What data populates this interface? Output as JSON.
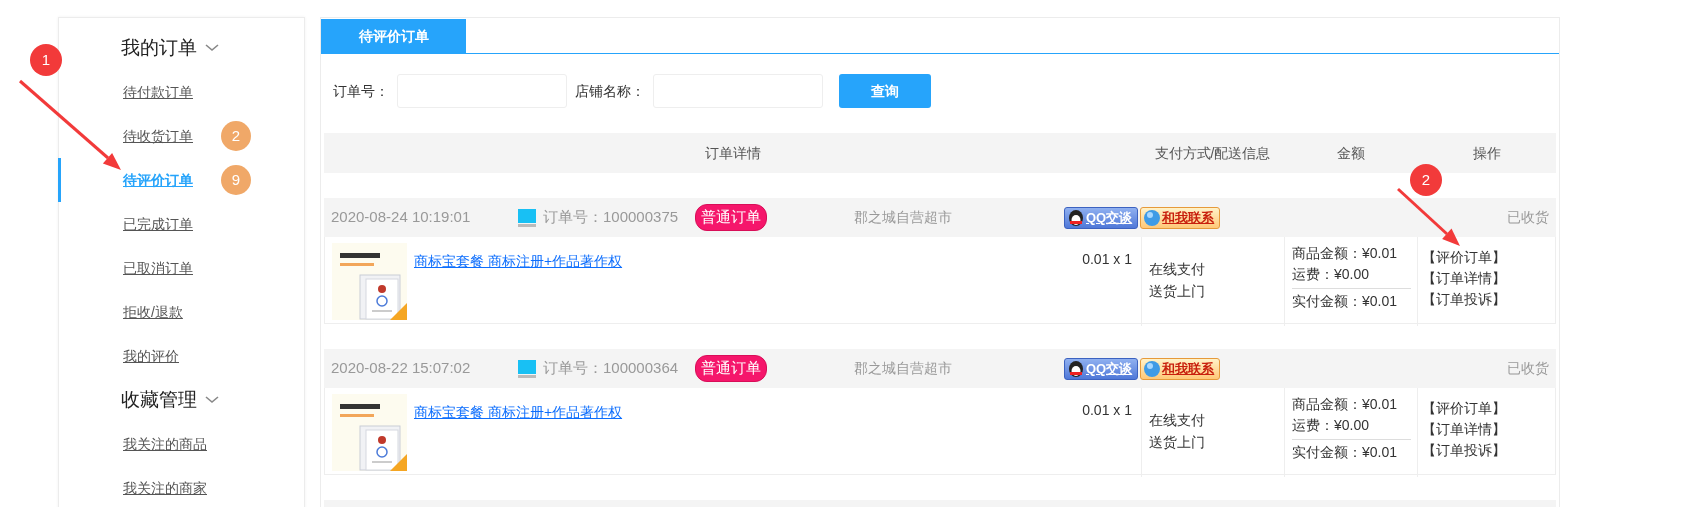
{
  "sidebar": {
    "sections": [
      {
        "title": "我的订单",
        "expanded": true,
        "items": [
          {
            "label": "待付款订单",
            "selected": false
          },
          {
            "label": "待收货订单",
            "selected": false,
            "badge": "2"
          },
          {
            "label": "待评价订单",
            "selected": true,
            "badge": "9"
          },
          {
            "label": "已完成订单",
            "selected": false
          },
          {
            "label": "已取消订单",
            "selected": false
          },
          {
            "label": "拒收/退款",
            "selected": false
          },
          {
            "label": "我的评价",
            "selected": false
          }
        ]
      },
      {
        "title": "收藏管理",
        "expanded": true,
        "items": [
          {
            "label": "我关注的商品",
            "selected": false
          },
          {
            "label": "我关注的商家",
            "selected": false
          }
        ]
      }
    ]
  },
  "tabs": [
    {
      "label": "待评价订单",
      "selected": true
    }
  ],
  "filters": [
    {
      "label": "订单号："
    },
    {
      "label": "店铺名称："
    }
  ],
  "search_button": "查询",
  "table": {
    "columns": [
      "订单详情",
      "支付方式/配送信息",
      "金额",
      "操作"
    ]
  },
  "orders": [
    {
      "time": "2020-08-24 10:19:01",
      "order_no": "订单号：100000375",
      "type_tag": "普通订单",
      "shop": "郡之城自营超市",
      "chat_button": "QQ交谈",
      "contact_button": "和我联系",
      "status": "已收货",
      "product": "商标宝套餐 商标注册+作品著作权",
      "price_qty": "0.01 x 1",
      "payment": "在线支付",
      "delivery": "送货上门",
      "goods_amount": "商品金额：¥0.01",
      "shipping": "运费：¥0.00",
      "paid": "实付金额：¥0.01",
      "actions": [
        "【评价订单】",
        "【订单详情】",
        "【订单投诉】"
      ]
    },
    {
      "time": "2020-08-22 15:07:02",
      "order_no": "订单号：100000364",
      "type_tag": "普通订单",
      "shop": "郡之城自营超市",
      "chat_button": "QQ交谈",
      "contact_button": "和我联系",
      "status": "已收货",
      "product": "商标宝套餐 商标注册+作品著作权",
      "price_qty": "0.01 x 1",
      "payment": "在线支付",
      "delivery": "送货上门",
      "goods_amount": "商品金额：¥0.01",
      "shipping": "运费：¥0.00",
      "paid": "实付金额：¥0.01",
      "actions": [
        "【评价订单】",
        "【订单详情】",
        "【订单投诉】"
      ]
    }
  ],
  "annotations": [
    {
      "label": "1"
    },
    {
      "label": "2"
    }
  ]
}
